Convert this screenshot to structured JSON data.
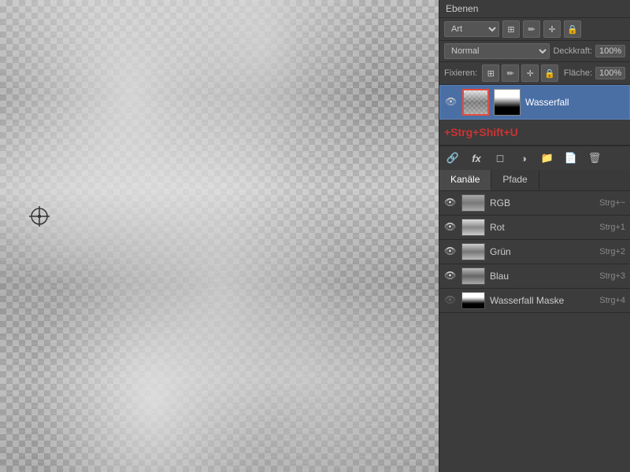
{
  "panel": {
    "title": "Ebenen",
    "type_label": "Art",
    "blend_mode": "Normal",
    "opacity_label": "Deckkraft:",
    "opacity_value": "100%",
    "fill_label": "Fläche:",
    "fill_value": "100%",
    "lock_label": "Fixieren:",
    "shortcut_text": "+Strg+Shift+U"
  },
  "layer": {
    "name": "Wasserfall"
  },
  "tabs": [
    {
      "label": "Kanäle",
      "active": true
    },
    {
      "label": "Pfade",
      "active": false
    }
  ],
  "channels": [
    {
      "name": "RGB",
      "shortcut": "Strg+~"
    },
    {
      "name": "Rot",
      "shortcut": "Strg+1"
    },
    {
      "name": "Grün",
      "shortcut": "Strg+2"
    },
    {
      "name": "Blau",
      "shortcut": "Strg+3"
    },
    {
      "name": "Wasserfall Maske",
      "shortcut": "Strg+4"
    }
  ],
  "icons": {
    "eye": "👁",
    "chain": "🔗",
    "fx": "fx",
    "folder": "📁",
    "trash": "🗑",
    "new_layer": "📄",
    "mask": "⬜",
    "adjust": "◑"
  }
}
